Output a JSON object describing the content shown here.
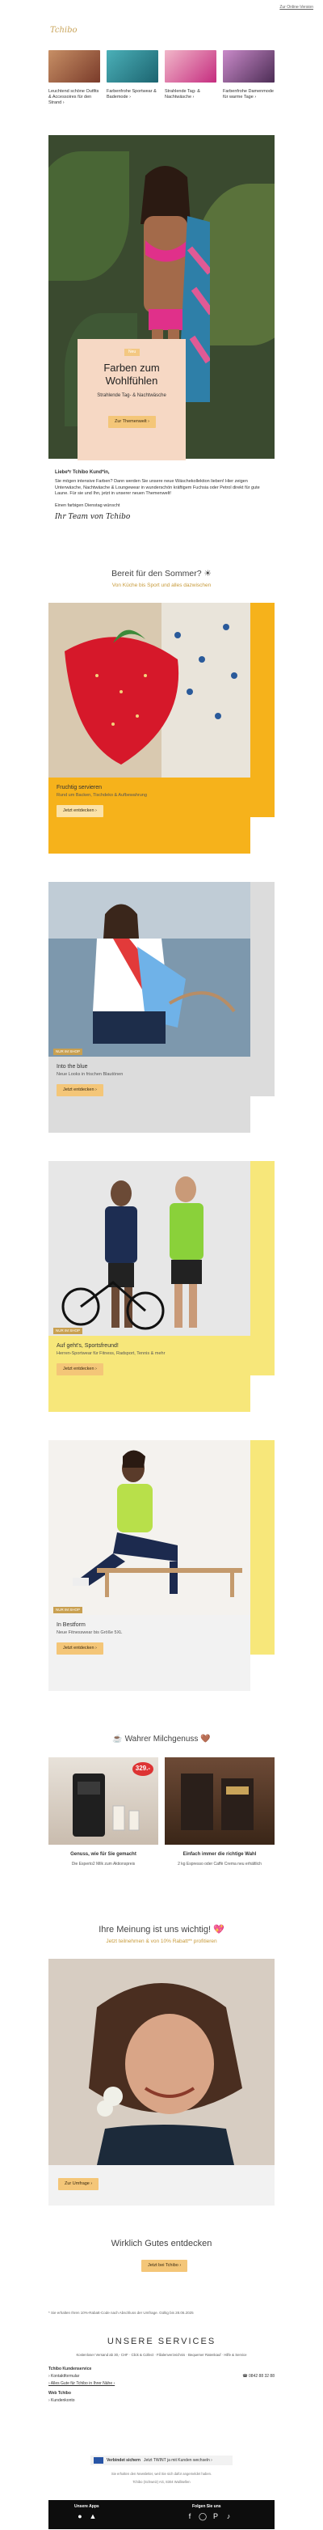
{
  "top_link": "Zur Online-Version",
  "logo_text": "Tchibo",
  "cards": [
    {
      "caption": "Leuchtend schöne Outfits & Accessoires für den Strand ›",
      "color": "#b97a5a"
    },
    {
      "caption": "Farbenfrohe Sportwear & Bademode ›",
      "color": "#4bb0b8"
    },
    {
      "caption": "Strahlende Tag- & Nachtwäsche ›",
      "color": "#d3428f"
    },
    {
      "caption": "Farbenfrohe Damenmode für warme Tage ›",
      "color": "#8a4e8f"
    }
  ],
  "hero": {
    "tag": "Neu",
    "title": "Farben zum Wohlfühlen",
    "subtitle": "Strahlende Tag- & Nachtwäsche",
    "button": "Zur Themenwelt ›"
  },
  "intro": {
    "greeting": "Liebe*r Tchibo Kund*in,",
    "text": "Sie mögen intensive Farben? Dann werden Sie unsere neue Wäschekollektion lieben! Hier zeigen Unterwäsche, Nachtwäsche & Loungewear in wunderschön kräftigem Fuchsia oder Petrol direkt für gute Laune. Für sie und Ihn, jetzt in unserer neuen Themenwelt!",
    "closing": "Einen farbigen Dienstag wünscht",
    "signature": "Ihr Team von Tchibo"
  },
  "summer": {
    "title": "Bereit für den Sommer? ☀",
    "subtitle": "Von Küche bis Sport und alles dazwischen"
  },
  "products": [
    {
      "badge": "",
      "title": "Fruchtig servieren",
      "desc": "Rund um Backen, Tischdeko & Aufbewahrung",
      "button": "Jetzt entdecken ›",
      "stripe": "#f6b21b",
      "info_bg": "#f6b21b"
    },
    {
      "badge": "NUR IM SHOP",
      "title": "Into the blue",
      "desc": "Neue Looks in frischen Blautönen",
      "button": "Jetzt entdecken ›",
      "stripe": "#dcdcdc",
      "info_bg": "#dcdcdc"
    },
    {
      "badge": "NUR IM SHOP",
      "title": "Auf geht's, Sportsfreund!",
      "desc": "Herren-Sportwear für Fitness, Radsport, Tennis & mehr",
      "button": "Jetzt entdecken ›",
      "stripe": "#f7e77a",
      "info_bg": "#f7e77a"
    },
    {
      "badge": "NUR IM SHOP",
      "title": "In Bestform",
      "desc": "Neue Fitnesswear bis Größe 5XL",
      "button": "Jetzt entdecken ›",
      "stripe": "#f7e77a",
      "info_bg": "#f2f2f2"
    }
  ],
  "milk": {
    "title": "☕ Wahrer Milchgenuss 🤎",
    "items": [
      {
        "caption": "Genuss, wie für Sie gemacht",
        "sub": "Die Esperto2 Milk zum Aktionspreis",
        "price": "329.-"
      },
      {
        "caption": "Einfach immer die richtige Wahl",
        "sub": "2 kg Espresso oder Caffè Crema neu erhältlich",
        "price": ""
      }
    ]
  },
  "survey": {
    "title": "Ihre Meinung ist uns wichtig! 💖",
    "subtitle": "Jetzt teilnehmen & von 10% Rabatt** profitieren",
    "button": "Zur Umfrage ›"
  },
  "discover": {
    "title": "Wirklich Gutes entdecken",
    "button": "Jetzt bei Tchibo ›"
  },
  "fine_print": "* Sie erhalten Ihren 10%-Rabatt-Code nach Abschluss der Umfrage. Gültig bis 28.06.2025",
  "services": {
    "title": "UNSERE SERVICES",
    "links": "Kostenloser Versand ab 30,- CHF · Click & Collect · Filialenverzeichnis · Bequemer Ratenkauf · Hilfe & Service"
  },
  "contact": {
    "heading": "Tchibo Kundenservice",
    "form": "› Kontaktformular",
    "phone": "☎ 0842 88 32 88",
    "link": "› Alles Gute für Tchibo in Ihrer Nähe ›",
    "web_heading": "Web Tchibo",
    "web": "› Kundenkonto"
  },
  "secure": {
    "label": "Verbindet sichern",
    "text": "Jetzt TWINT ja mit Kunden wechseln ›"
  },
  "footnotes": [
    "Sie erhalten den Newsletter, weil Sie sich dafür angemeldet haben.",
    "Tchibo (Schweiz) AG, 8304 Wallisellen"
  ],
  "bar": {
    "apps": "Unsere Apps",
    "follow": "Folgen Sie uns"
  }
}
